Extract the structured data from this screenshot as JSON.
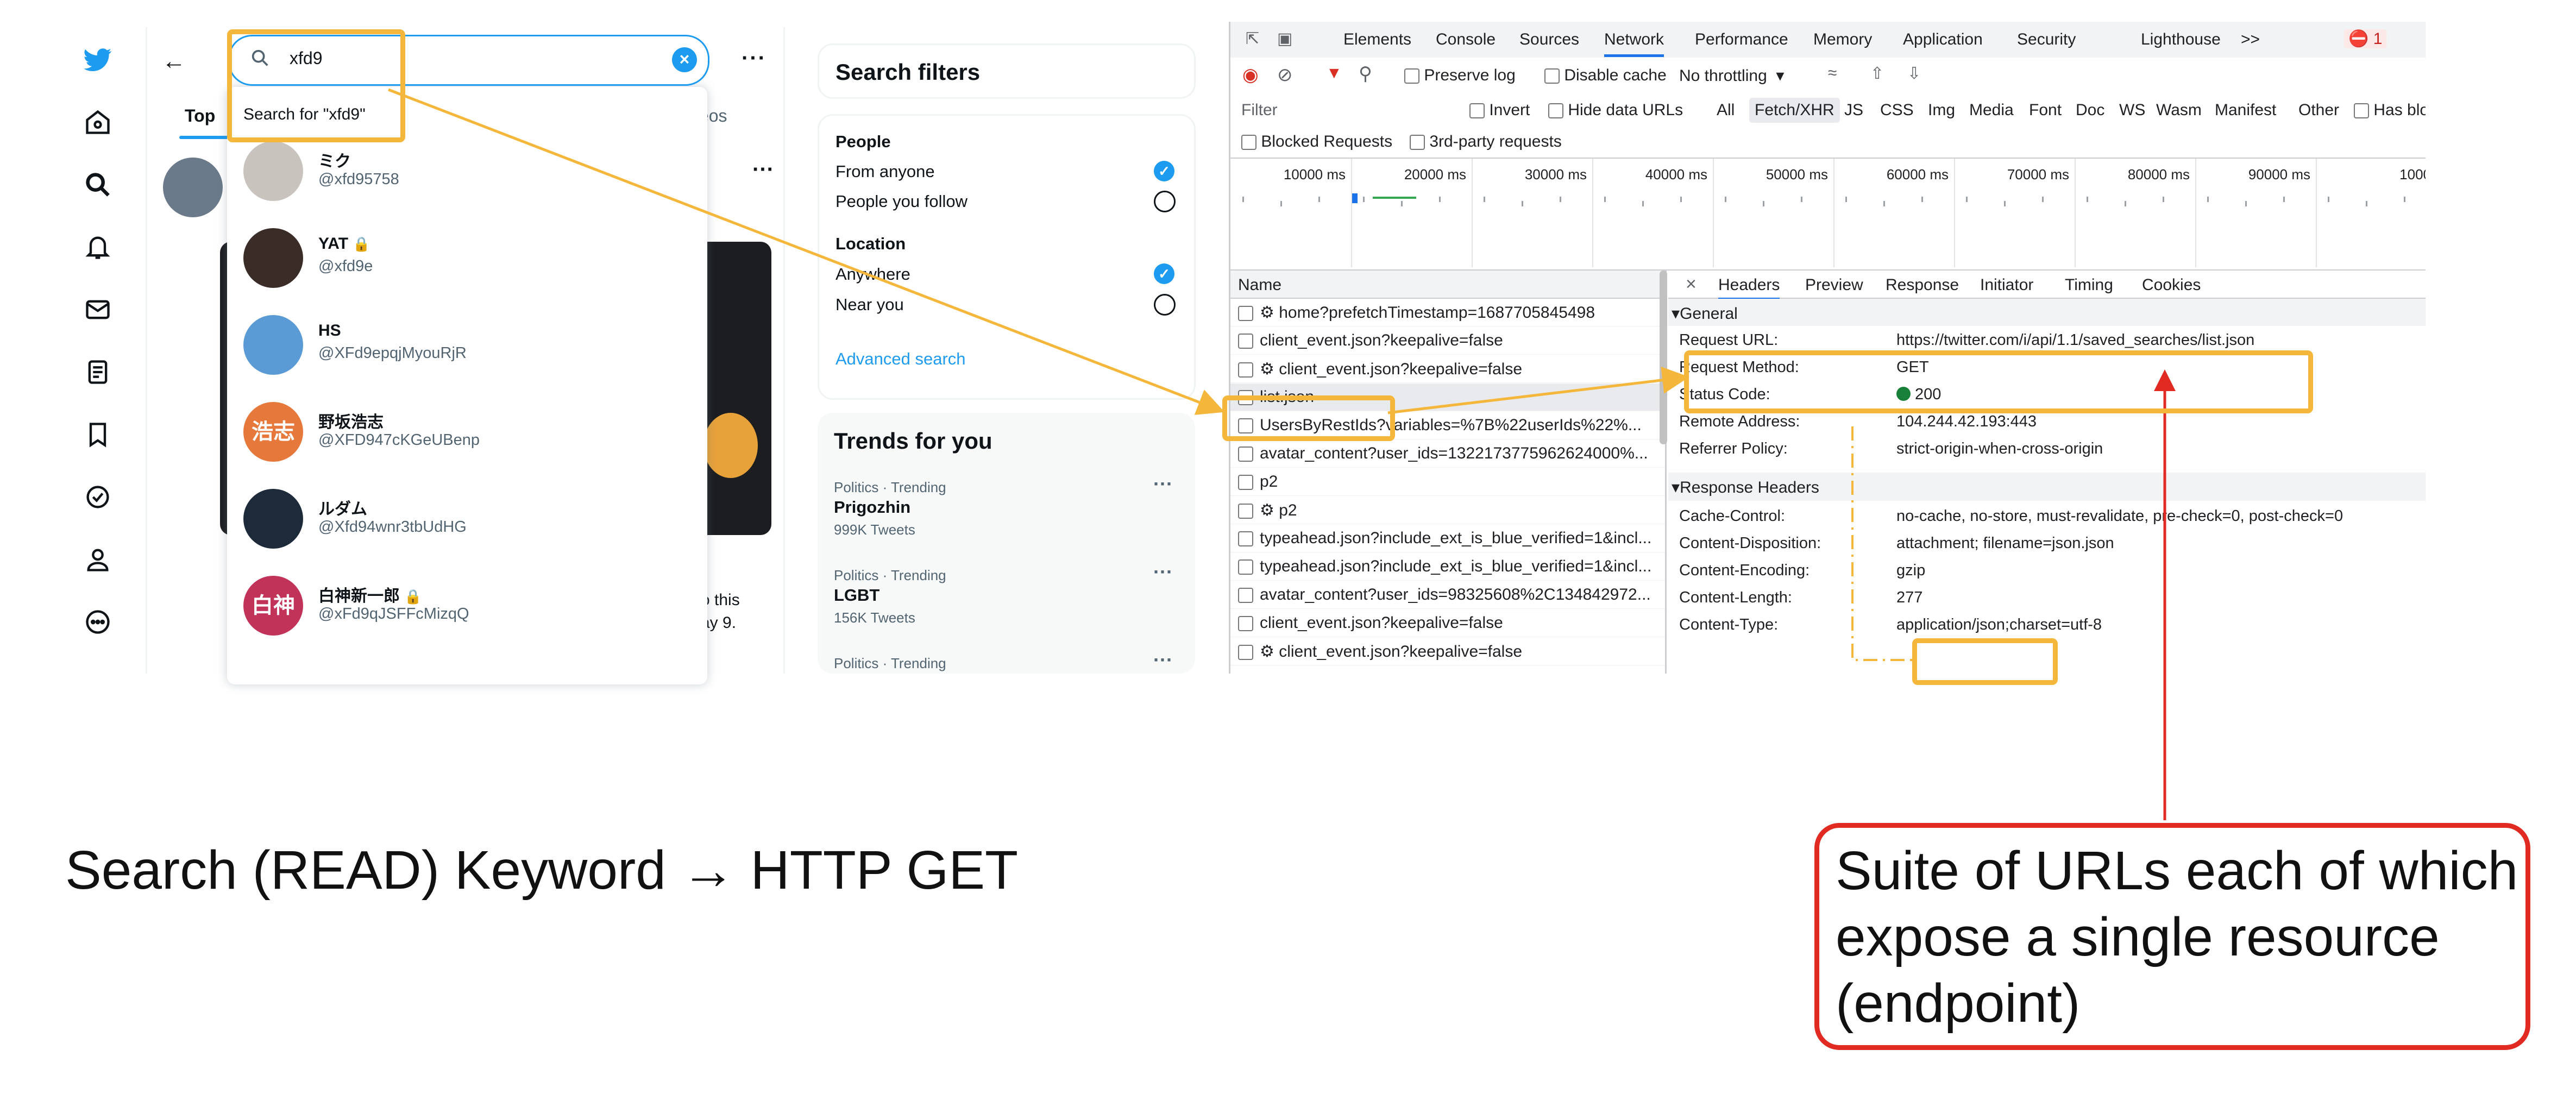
{
  "twitter": {
    "search": {
      "query": "xfd9",
      "suggestion": "Search for \"xfd9\""
    },
    "tabs": {
      "top": "Top",
      "videos": "ideos"
    },
    "users": [
      {
        "name": "ミク",
        "handle": "@xfd95758",
        "avatar_color": "#c9c3bd"
      },
      {
        "name": "YAT",
        "handle": "@xfd9e",
        "avatar_color": "#3a2c26",
        "locked": true
      },
      {
        "name": "HS",
        "handle": "@XFd9epqjMyouRjR",
        "avatar_color": "#5b9bd5"
      },
      {
        "name": "野坂浩志",
        "handle": "@XFD947cKGeUBenp",
        "avatar_color": "#e5783a",
        "avatar_text": "浩志"
      },
      {
        "name": "ルダム",
        "handle": "@Xfd94wnr3tbUdHG",
        "avatar_color": "#1c2a3a"
      },
      {
        "name": "白神新一郎",
        "handle": "@xFd9qJSFFcMizqQ",
        "avatar_color": "#c2335a",
        "avatar_text": "白神",
        "locked": true
      }
    ],
    "background_text": [
      "o this",
      "ay 9."
    ],
    "search_filters": {
      "title": "Search filters",
      "people_heading": "People",
      "people_options": [
        "From anyone",
        "People you follow"
      ],
      "location_heading": "Location",
      "location_options": [
        "Anywhere",
        "Near you"
      ],
      "advanced": "Advanced search"
    },
    "trends": {
      "title": "Trends for you",
      "items": [
        {
          "meta": "Politics · Trending",
          "name": "Prigozhin",
          "count": "999K Tweets"
        },
        {
          "meta": "Politics · Trending",
          "name": "LGBT",
          "count": "156K Tweets"
        },
        {
          "meta": "Politics · Trending",
          "name": "",
          "count": ""
        }
      ]
    }
  },
  "devtools": {
    "panel_tabs": [
      "Elements",
      "Console",
      "Sources",
      "Network",
      "Performance",
      "Memory",
      "Application",
      "Security",
      "Lighthouse",
      ">>"
    ],
    "active_panel": "Network",
    "error_count": "1",
    "toolbar": {
      "preserve_log": "Preserve log",
      "disable_cache": "Disable cache",
      "throttling": "No throttling"
    },
    "filter_bar": {
      "placeholder": "Filter",
      "invert": "Invert",
      "hide_data": "Hide data URLs",
      "types": [
        "All",
        "Fetch/XHR",
        "JS",
        "CSS",
        "Img",
        "Media",
        "Font",
        "Doc",
        "WS",
        "Wasm",
        "Manifest",
        "Other"
      ],
      "has_blocked": "Has bloc",
      "blocked_requests": "Blocked Requests",
      "third_party": "3rd-party requests"
    },
    "timeline_labels": [
      "10000 ms",
      "20000 ms",
      "30000 ms",
      "40000 ms",
      "50000 ms",
      "60000 ms",
      "70000 ms",
      "80000 ms",
      "90000 ms",
      "1000"
    ],
    "name_column": "Name",
    "requests": [
      "⚙ home?prefetchTimestamp=1687705845498",
      "client_event.json?keepalive=false",
      "⚙ client_event.json?keepalive=false",
      "list.json",
      "UsersByRestIds?variables=%7B%22userIds%22%...",
      "avatar_content?user_ids=1322173775962624000%...",
      "p2",
      "⚙ p2",
      "typeahead.json?include_ext_is_blue_verified=1&incl...",
      "typeahead.json?include_ext_is_blue_verified=1&incl...",
      "avatar_content?user_ids=98325608%2C134842972...",
      "client_event.json?keepalive=false",
      "⚙ client_event.json?keepalive=false"
    ],
    "detail_tabs": [
      "Headers",
      "Preview",
      "Response",
      "Initiator",
      "Timing",
      "Cookies"
    ],
    "general_section": "General",
    "general": [
      {
        "key": "Request URL:",
        "value": "https://twitter.com/i/api/1.1/saved_searches/list.json"
      },
      {
        "key": "Request Method:",
        "value": "GET"
      },
      {
        "key": "Status Code:",
        "value": "200"
      },
      {
        "key": "Remote Address:",
        "value": "104.244.42.193:443"
      },
      {
        "key": "Referrer Policy:",
        "value": "strict-origin-when-cross-origin"
      }
    ],
    "response_section": "Response Headers",
    "response_headers": [
      {
        "key": "Cache-Control:",
        "value": "no-cache, no-store, must-revalidate, pre-check=0, post-check=0"
      },
      {
        "key": "Content-Disposition:",
        "value": "attachment; filename=json.json"
      },
      {
        "key": "Content-Encoding:",
        "value": "gzip"
      },
      {
        "key": "Content-Length:",
        "value": "277"
      },
      {
        "key": "Content-Type:",
        "value": "application/json;charset=utf-8"
      }
    ]
  },
  "annotations": {
    "caption": "Search (READ) Keyword → HTTP GET",
    "callout": "Suite of URLs each of which expose a single resource (endpoint)",
    "highlight_color": "#f5b73b",
    "callout_color": "#e12b22"
  }
}
